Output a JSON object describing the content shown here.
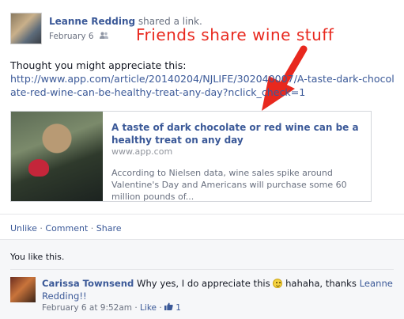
{
  "post": {
    "author": "Leanne Redding",
    "action": "shared a link.",
    "date": "February 6",
    "audience_icon": "friends-icon",
    "message": "Thought you might appreciate this:",
    "url": "http://www.app.com/article/20140204/NJLIFE/302040007/A-taste-dark-chocolate-red-wine-can-be-healthy-treat-any-day?nclick_check=1"
  },
  "annotation": {
    "text": "Friends share wine stuff",
    "color": "#e8281e"
  },
  "link_card": {
    "title": "A taste of dark chocolate or red wine can be a healthy treat on any day",
    "domain": "www.app.com",
    "description": "According to Nielsen data, wine sales spike around Valentine's Day and Americans will purchase some 60 million pounds of..."
  },
  "actions": {
    "unlike": "Unlike",
    "comment": "Comment",
    "share": "Share",
    "separator": "·"
  },
  "likes": {
    "text": "You like this."
  },
  "comment": {
    "author": "Carissa Townsend",
    "text_before": "Why yes, I do appreciate this",
    "text_after": "hahaha, thanks",
    "mention": "Leanne Redding!!",
    "timestamp": "February 6 at 9:52am",
    "like_label": "Like",
    "like_count": "1"
  },
  "colors": {
    "link": "#3b5998",
    "muted": "#6a7180",
    "annotation": "#e8281e"
  }
}
